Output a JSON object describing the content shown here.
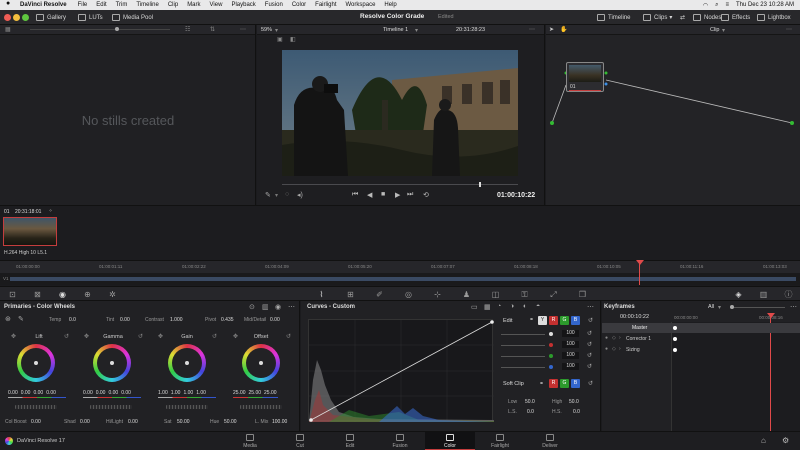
{
  "menubar": {
    "app_name": "DaVinci Resolve",
    "items": [
      "File",
      "Edit",
      "Trim",
      "Timeline",
      "Clip",
      "Mark",
      "View",
      "Playback",
      "Fusion",
      "Color",
      "Fairlight",
      "Workspace",
      "Help"
    ],
    "datetime": "Thu Dec 23  10:28 AM"
  },
  "toolbar": {
    "gallery": "Gallery",
    "luts": "LUTs",
    "media_pool": "Media Pool",
    "project_title": "Resolve Color Grade",
    "project_status": "Edited",
    "timeline": "Timeline",
    "clips": "Clips",
    "nodes": "Nodes",
    "effects": "Effects",
    "lightbox": "Lightbox"
  },
  "gallery": {
    "empty_text": "No stills created"
  },
  "viewer": {
    "zoom": "59%",
    "timeline_name": "Timeline 1",
    "source_timecode": "20:31:28:23",
    "current_timecode": "01:00:10:22"
  },
  "nodes": {
    "mode": "Clip",
    "node_label": "01"
  },
  "clipstrip": {
    "clip_number": "01",
    "clip_timecode": "20:31:18:01",
    "codec": "H.264 High 10 L5.1"
  },
  "ruler": [
    "01:00:00:00",
    "01:00:01:11",
    "01:00:02:22",
    "01:00:04:09",
    "01:00:05:20",
    "01:00:07:07",
    "01:00:08:18",
    "01:00:10:05",
    "01:00:11:16",
    "01:00:13:03"
  ],
  "primaries": {
    "title": "Primaries - Color Wheels",
    "temp_label": "Temp",
    "temp": "0.0",
    "tint_label": "Tint",
    "tint": "0.00",
    "contrast_label": "Contrast",
    "contrast": "1.000",
    "pivot_label": "Pivot",
    "pivot": "0.435",
    "middetail_label": "Mid/Detail",
    "middetail": "0.00",
    "wheels": [
      {
        "name": "Lift",
        "vals": [
          "0.00",
          "0.00",
          "0.00",
          "0.00"
        ]
      },
      {
        "name": "Gamma",
        "vals": [
          "0.00",
          "0.00",
          "0.00",
          "0.00"
        ]
      },
      {
        "name": "Gain",
        "vals": [
          "1.00",
          "1.00",
          "1.00",
          "1.00"
        ]
      },
      {
        "name": "Offset",
        "vals": [
          "25.00",
          "25.00",
          "25.00"
        ]
      }
    ],
    "colboost_label": "Col Boost",
    "colboost": "0.00",
    "shad_label": "Shad",
    "shad": "0.00",
    "hilight_label": "Hi/Light",
    "hilight": "0.00",
    "sat_label": "Sat",
    "sat": "50.00",
    "hue_label": "Hue",
    "hue": "50.00",
    "lmix_label": "L. Mix",
    "lmix": "100.00"
  },
  "curves": {
    "title": "Curves - Custom",
    "edit_label": "Edit",
    "edit_vals": [
      "100",
      "100",
      "100",
      "100"
    ],
    "softclip_label": "Soft Clip",
    "low_label": "Low",
    "low": "50.0",
    "high_label": "High",
    "high": "50.0",
    "ls_label": "L.S.",
    "ls": "0.0",
    "hs_label": "H.S.",
    "hs": "0.0"
  },
  "keyframes": {
    "title": "Keyframes",
    "filter": "All",
    "timecode": "00:00:10:22",
    "ruler_start": "00:00:00:00",
    "ruler_mark": "00:00:08:16",
    "rows": [
      "Master",
      "Corrector 1",
      "Sizing"
    ]
  },
  "pagebar": {
    "app_version": "DaVinci Resolve 17",
    "pages": [
      "Media",
      "Cut",
      "Edit",
      "Fusion",
      "Color",
      "Fairlight",
      "Deliver"
    ],
    "active": "Color"
  },
  "colors": {
    "accent_red": "#c43d3d",
    "playhead": "#e04a4a"
  }
}
